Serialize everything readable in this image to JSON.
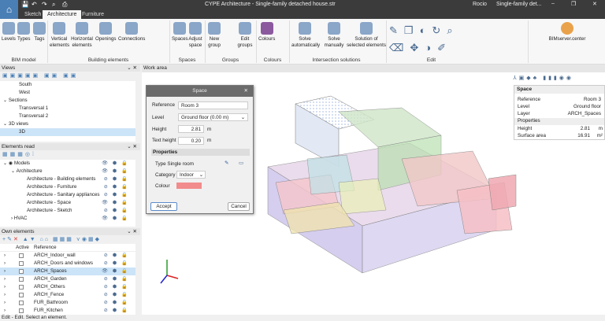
{
  "app": {
    "title": "CYPE Architecture - Single-family detached house.str",
    "user": "Rocio",
    "project": "Single-family det...",
    "minimize": "–",
    "maximize": "❐",
    "close": "✕"
  },
  "tabs": [
    "Sketch",
    "Architecture",
    "Furniture"
  ],
  "ribbon": {
    "bim_model": {
      "label": "BIM model",
      "buttons": [
        "Levels",
        "Types",
        "Tags"
      ]
    },
    "building_elements": {
      "label": "Building elements",
      "buttons": [
        "Vertical elements",
        "Horizontal elements",
        "Openings",
        "Connections"
      ]
    },
    "spaces": {
      "label": "Spaces",
      "buttons": [
        "Spaces",
        "Adjust space"
      ]
    },
    "groups": {
      "label": "Groups",
      "buttons": [
        "New group",
        "Edit groups"
      ]
    },
    "colours": {
      "label": "Colours",
      "buttons": [
        "Colours"
      ]
    },
    "intersection": {
      "label": "Intersection solutions",
      "buttons": [
        "Solve automatically",
        "Solve manually",
        "Solution of selected elements"
      ]
    },
    "edit": {
      "label": "Edit"
    },
    "bimserver": "BIMserver.center"
  },
  "views": {
    "title": "Views",
    "items": [
      {
        "label": "South",
        "level": 2
      },
      {
        "label": "West",
        "level": 2
      },
      {
        "label": "Sections",
        "level": 1,
        "expanded": true
      },
      {
        "label": "Transversal 1",
        "level": 2
      },
      {
        "label": "Transversal 2",
        "level": 2
      },
      {
        "label": "3D views",
        "level": 1,
        "expanded": true
      },
      {
        "label": "3D",
        "level": 2,
        "selected": true
      }
    ]
  },
  "elements_read": {
    "title": "Elements read",
    "items": [
      {
        "label": "Models",
        "level": 0
      },
      {
        "label": "Architecture",
        "level": 1
      },
      {
        "label": "Architecture - Building elements",
        "level": 2
      },
      {
        "label": "Architecture - Furniture",
        "level": 2
      },
      {
        "label": "Architecture - Sanitary appliances",
        "level": 2
      },
      {
        "label": "Architecture - Space",
        "level": 2
      },
      {
        "label": "Architecture - Sketch",
        "level": 2
      },
      {
        "label": "HVAC",
        "level": 1
      }
    ]
  },
  "own_elements": {
    "title": "Own elements",
    "columns": [
      "Active",
      "Reference"
    ],
    "rows": [
      {
        "ref": "ARCH_Indoor_wall"
      },
      {
        "ref": "ARCH_Doors and windows"
      },
      {
        "ref": "ARCH_Spaces",
        "selected": true
      },
      {
        "ref": "ARCH_Garden"
      },
      {
        "ref": "ARCH_Others"
      },
      {
        "ref": "ARCH_Fence"
      },
      {
        "ref": "FUR_Bathroom"
      },
      {
        "ref": "FUR_Kitchen"
      }
    ]
  },
  "work_area": {
    "title": "Work area"
  },
  "dialog": {
    "title": "Space",
    "reference_label": "Reference",
    "reference": "Room 3",
    "level_label": "Level",
    "level": "Ground floor (0.00 m)",
    "height_label": "Height",
    "height": "2.81",
    "text_height_label": "Text height",
    "text_height": "0.20",
    "unit": "m",
    "properties": "Properties",
    "type_label": "Type",
    "type": "Single room",
    "category_label": "Category",
    "category": "Indoor",
    "colour_label": "Colour",
    "colour": "#f28b8b",
    "accept": "Accept",
    "cancel": "Cancel"
  },
  "info": {
    "title": "Space",
    "rows": [
      {
        "k": "Reference",
        "v": "Room 3"
      },
      {
        "k": "Level",
        "v": "Ground floor"
      },
      {
        "k": "Layer",
        "v": "ARCH_Spaces"
      }
    ],
    "properties": "Properties",
    "props": [
      {
        "k": "Height",
        "v": "2.81",
        "u": "m"
      },
      {
        "k": "Surface area",
        "v": "16.91",
        "u": "m²"
      }
    ]
  },
  "status": "Edit - Edit. Select an element."
}
